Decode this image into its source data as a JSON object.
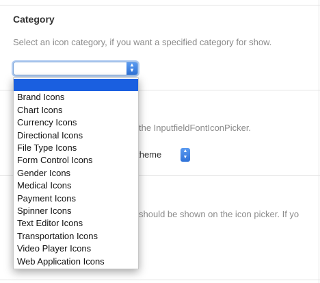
{
  "category": {
    "title": "Category",
    "description": "Select an icon category, if you want a specified category for show.",
    "selected_value": "",
    "options": [
      "",
      "Brand Icons",
      "Chart Icons",
      "Currency Icons",
      "Directional Icons",
      "File Type Icons",
      "Form Control Icons",
      "Gender Icons",
      "Medical Icons",
      "Payment Icons",
      "Spinner Icons",
      "Text Editor Icons",
      "Transportation Icons",
      "Video Player Icons",
      "Web Application Icons"
    ]
  },
  "partial_texts": {
    "line1": "the InputfieldFontIconPicker.",
    "theme_select_label": "y theme",
    "line2": "should be shown on the icon picker. If yo"
  },
  "colors": {
    "selected_option": "#1a5fe0",
    "stepper": "#2f72d8"
  },
  "icons": {
    "select_stepper": "up-down-chevron-icon"
  }
}
